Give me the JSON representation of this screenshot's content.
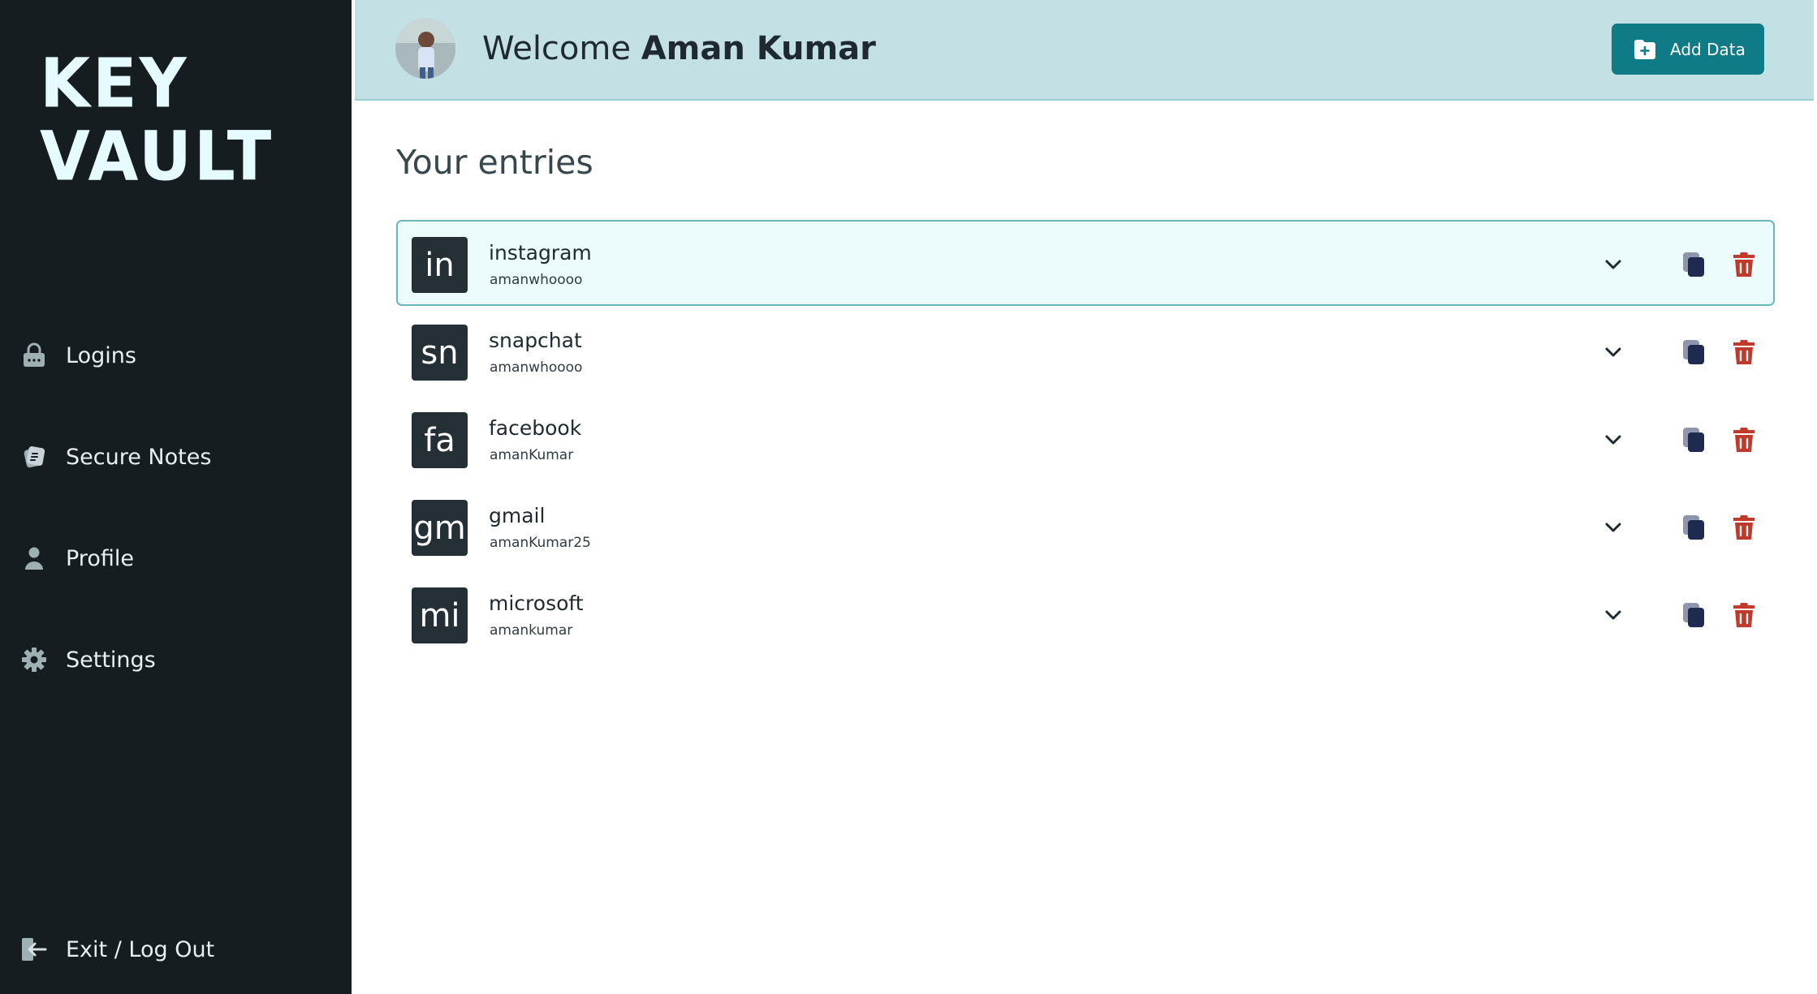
{
  "sidebar": {
    "brand_line1": "KEY",
    "brand_line2": "VAULT",
    "items": [
      {
        "label": "Logins",
        "icon": "lock-icon"
      },
      {
        "label": "Secure Notes",
        "icon": "note-icon"
      },
      {
        "label": "Profile",
        "icon": "person-icon"
      },
      {
        "label": "Settings",
        "icon": "gear-icon"
      }
    ],
    "logout_label": "Exit / Log Out",
    "logout_icon": "logout-arrow-icon"
  },
  "header": {
    "welcome_prefix": "Welcome",
    "user_name": "Aman Kumar",
    "add_button_label": "Add Data",
    "add_button_icon": "folder-plus-icon"
  },
  "main": {
    "title": "Your entries",
    "entries": [
      {
        "badge": "in",
        "site": "instagram",
        "username": "amanwhoooo"
      },
      {
        "badge": "sn",
        "site": "snapchat",
        "username": "amanwhoooo"
      },
      {
        "badge": "fa",
        "site": "facebook",
        "username": "amanKumar"
      },
      {
        "badge": "gm",
        "site": "gmail",
        "username": "amanKumar25"
      },
      {
        "badge": "mi",
        "site": "microsoft",
        "username": "amankumar"
      }
    ]
  },
  "colors": {
    "sidebar_bg": "#161d21",
    "header_bg": "#c3e0e5",
    "accent": "#0e7b86",
    "delete": "#c0392b",
    "copy": "#1e2a50"
  }
}
